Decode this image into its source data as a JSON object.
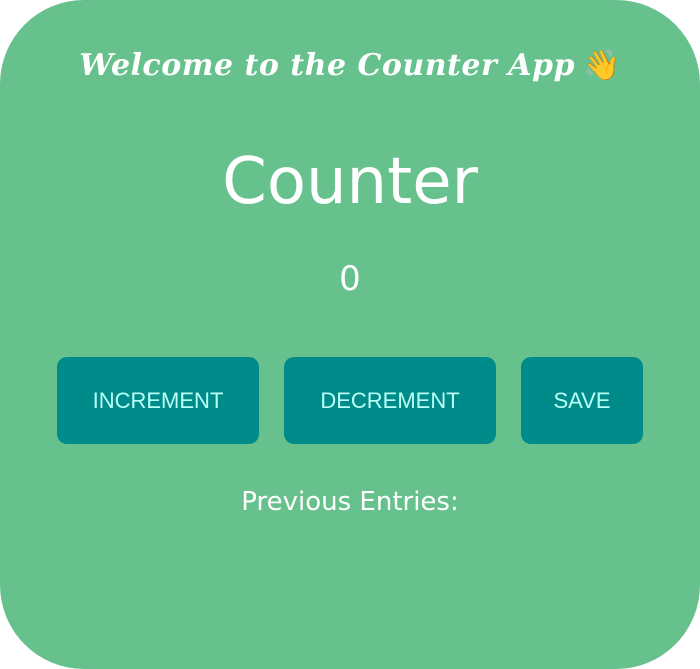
{
  "header": {
    "welcome_text": "Welcome to the Counter App",
    "wave_emoji": "👋"
  },
  "counter": {
    "title": "Counter",
    "value": "0"
  },
  "actions": {
    "increment_label": "INCREMENT",
    "decrement_label": "DECREMENT",
    "save_label": "SAVE"
  },
  "entries": {
    "label": "Previous Entries:",
    "items": []
  },
  "colors": {
    "background": "#66c18c",
    "button": "#008b8b",
    "button_text": "#b8fff6",
    "text": "#ffffff"
  }
}
